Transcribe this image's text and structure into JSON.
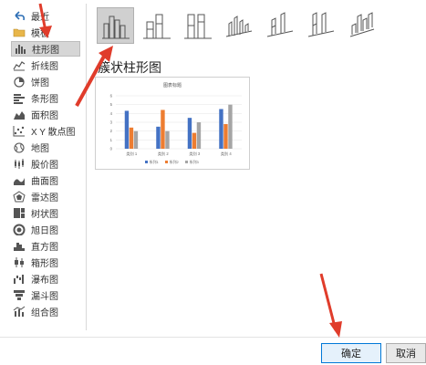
{
  "sidebar": {
    "items": [
      {
        "label": "最近",
        "icon": "undo-icon"
      },
      {
        "label": "模板",
        "icon": "folder-icon"
      },
      {
        "label": "柱形图",
        "icon": "column-chart-icon",
        "selected": true
      },
      {
        "label": "折线图",
        "icon": "line-chart-icon"
      },
      {
        "label": "饼图",
        "icon": "pie-chart-icon"
      },
      {
        "label": "条形图",
        "icon": "bar-chart-icon"
      },
      {
        "label": "面积图",
        "icon": "area-chart-icon"
      },
      {
        "label": "X Y 散点图",
        "icon": "scatter-chart-icon"
      },
      {
        "label": "地图",
        "icon": "map-chart-icon"
      },
      {
        "label": "股价图",
        "icon": "stock-chart-icon"
      },
      {
        "label": "曲面图",
        "icon": "surface-chart-icon"
      },
      {
        "label": "雷达图",
        "icon": "radar-chart-icon"
      },
      {
        "label": "树状图",
        "icon": "treemap-chart-icon"
      },
      {
        "label": "旭日图",
        "icon": "sunburst-chart-icon"
      },
      {
        "label": "直方图",
        "icon": "histogram-chart-icon"
      },
      {
        "label": "箱形图",
        "icon": "box-whisker-chart-icon"
      },
      {
        "label": "瀑布图",
        "icon": "waterfall-chart-icon"
      },
      {
        "label": "漏斗图",
        "icon": "funnel-chart-icon"
      },
      {
        "label": "组合图",
        "icon": "combo-chart-icon"
      }
    ]
  },
  "subtypes": [
    {
      "name": "clustered-column",
      "selected": true
    },
    {
      "name": "stacked-column"
    },
    {
      "name": "percent-stacked-column"
    },
    {
      "name": "3d-clustered-column"
    },
    {
      "name": "3d-stacked-column"
    },
    {
      "name": "3d-percent-stacked-column"
    },
    {
      "name": "3d-column"
    }
  ],
  "heading": "簇状柱形图",
  "preview": {
    "title": "图表标题",
    "categories": [
      "类别 1",
      "类别 2",
      "类别 3",
      "类别 4"
    ],
    "series": [
      {
        "name": "系列1",
        "values": [
          4.3,
          2.5,
          3.5,
          4.5
        ]
      },
      {
        "name": "系列2",
        "values": [
          2.4,
          4.4,
          1.8,
          2.8
        ]
      },
      {
        "name": "系列3",
        "values": [
          2.0,
          2.0,
          3.0,
          5.0
        ]
      }
    ],
    "yticks": [
      "0",
      "1",
      "2",
      "3",
      "4",
      "5",
      "6"
    ],
    "ylim": [
      0,
      6
    ],
    "colors": [
      "#4472c4",
      "#ed7d31",
      "#a5a5a5"
    ]
  },
  "buttons": {
    "ok": "确定",
    "cancel": "取消"
  },
  "colors": {
    "arrow": "#e03c2b",
    "selected_bg": "#d0d0d0",
    "primary_border": "#0078d7"
  }
}
